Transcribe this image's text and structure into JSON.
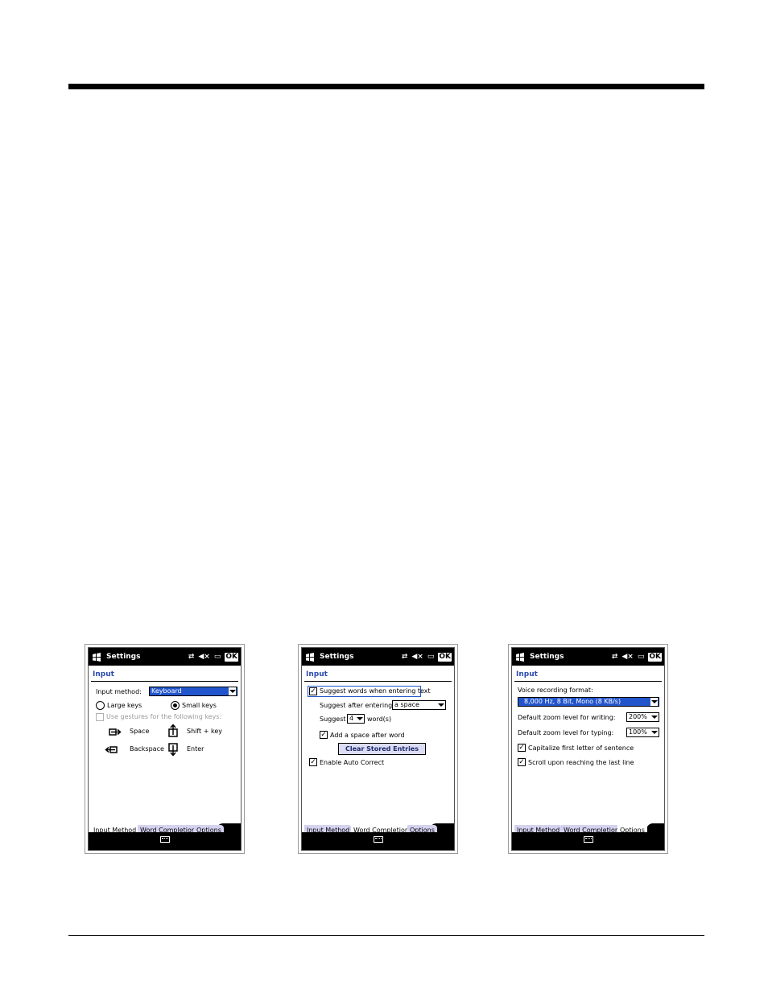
{
  "screens": [
    {
      "title": "Settings",
      "heading": "Input",
      "input_method_label": "Input method:",
      "input_method_value": "Keyboard",
      "large_keys": "Large keys",
      "small_keys": "Small keys",
      "use_gestures": "Use gestures for the following keys:",
      "space": "Space",
      "shift_key": "Shift + key",
      "backspace": "Backspace",
      "enter": "Enter",
      "tabs": [
        "Input Method",
        "Word Completion",
        "Options"
      ],
      "active_tab": 0
    },
    {
      "title": "Settings",
      "heading": "Input",
      "suggest_words": "Suggest words when entering text",
      "suggest_after_label": "Suggest after entering",
      "suggest_after_value": "a space",
      "suggest_label": "Suggest",
      "suggest_count": "4",
      "words_label": "word(s)",
      "add_space": "Add a space after word",
      "clear_button": "Clear Stored Entries",
      "auto_correct": "Enable Auto Correct",
      "tabs": [
        "Input Method",
        "Word Completion",
        "Options"
      ],
      "active_tab": 1
    },
    {
      "title": "Settings",
      "heading": "Input",
      "voice_label": "Voice recording format:",
      "voice_value": "8,000 Hz, 8 Bit, Mono (8 KB/s)",
      "zoom_writing_label": "Default zoom level for writing:",
      "zoom_writing_value": "200%",
      "zoom_typing_label": "Default zoom level for typing:",
      "zoom_typing_value": "100%",
      "capitalize": "Capitalize first letter of sentence",
      "scroll": "Scroll upon reaching the last line",
      "tabs": [
        "Input Method",
        "Word Completion",
        "Options"
      ],
      "active_tab": 2
    }
  ],
  "status_icons": [
    "connectivity-icon",
    "volume-muted-icon",
    "battery-icon"
  ],
  "ok_label": "OK",
  "colors": {
    "heading_blue": "#2a4ab0",
    "selection_blue": "#2255cc",
    "tab_lavender": "#d4d2ef"
  }
}
